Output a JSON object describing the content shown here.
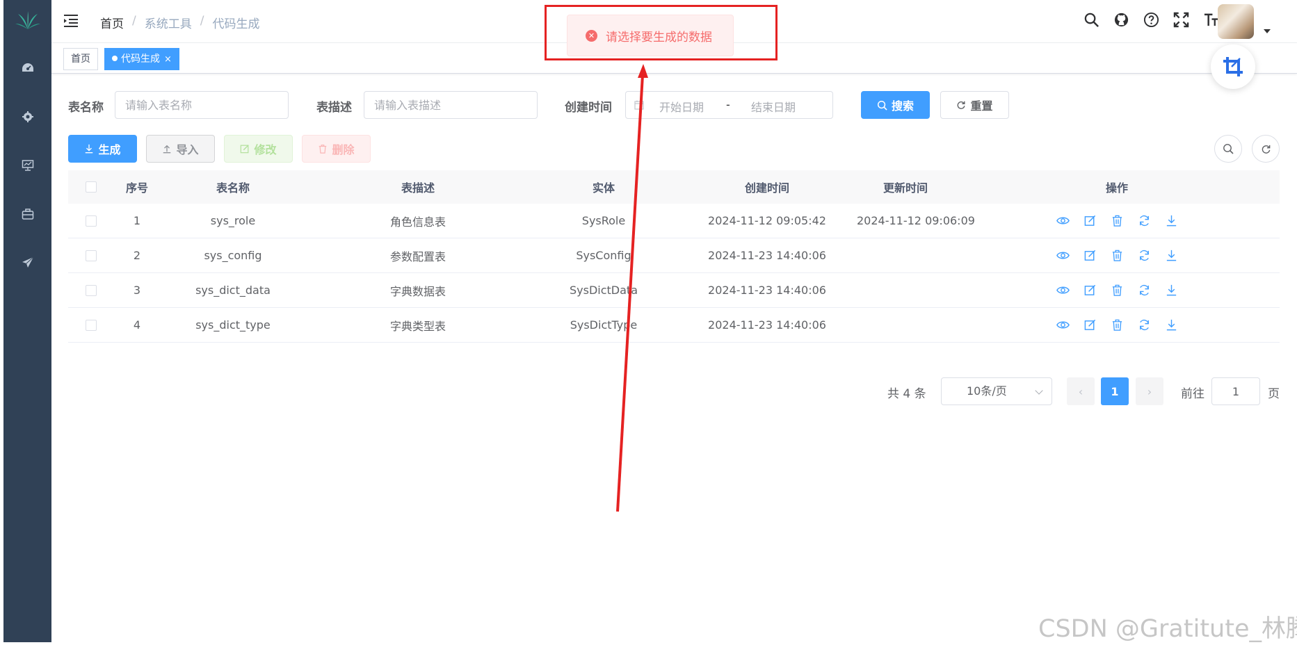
{
  "sidebar": {
    "logo": "leaf-logo",
    "items": [
      {
        "icon": "dashboard-icon"
      },
      {
        "icon": "gear-icon"
      },
      {
        "icon": "monitor-icon"
      },
      {
        "icon": "toolbox-icon"
      },
      {
        "icon": "send-icon"
      }
    ]
  },
  "header": {
    "breadcrumb": {
      "home": "首页",
      "sep1": "/",
      "mid": "系统工具",
      "sep2": "/",
      "current": "代码生成"
    },
    "icons": [
      "search-icon",
      "github-icon",
      "help-icon",
      "fullscreen-icon",
      "font-size-icon"
    ]
  },
  "tags": {
    "home": "首页",
    "active": "代码生成",
    "close": "×"
  },
  "search": {
    "table_name_label": "表名称",
    "table_name_placeholder": "请输入表名称",
    "table_desc_label": "表描述",
    "table_desc_placeholder": "请输入表描述",
    "create_time_label": "创建时间",
    "start_placeholder": "开始日期",
    "range_sep": "-",
    "end_placeholder": "结束日期",
    "search_button": "搜索",
    "reset_button": "重置"
  },
  "toolbar": {
    "generate": "生成",
    "import": "导入",
    "edit": "修改",
    "delete": "删除"
  },
  "table": {
    "columns": {
      "index": "序号",
      "name": "表名称",
      "desc": "表描述",
      "entity": "实体",
      "created": "创建时间",
      "updated": "更新时间",
      "ops": "操作"
    },
    "rows": [
      {
        "index": "1",
        "name": "sys_role",
        "desc": "角色信息表",
        "entity": "SysRole",
        "created": "2024-11-12 09:05:42",
        "updated": "2024-11-12 09:06:09"
      },
      {
        "index": "2",
        "name": "sys_config",
        "desc": "参数配置表",
        "entity": "SysConfig",
        "created": "2024-11-23 14:40:06",
        "updated": ""
      },
      {
        "index": "3",
        "name": "sys_dict_data",
        "desc": "字典数据表",
        "entity": "SysDictData",
        "created": "2024-11-23 14:40:06",
        "updated": ""
      },
      {
        "index": "4",
        "name": "sys_dict_type",
        "desc": "字典类型表",
        "entity": "SysDictType",
        "created": "2024-11-23 14:40:06",
        "updated": ""
      }
    ]
  },
  "pagination": {
    "total": "共 4 条",
    "page_size": "10条/页",
    "prev": "‹",
    "current": "1",
    "next": "›",
    "goto_label": "前往",
    "goto_value": "1",
    "page_label": "页"
  },
  "toast": {
    "message": "请选择要生成的数据",
    "icon": "error-circle-icon"
  },
  "watermark": "CSDN @Gratitute_林腾",
  "colors": {
    "primary": "#409eff",
    "sidebar": "#304156",
    "error": "#f56c6c",
    "annotation": "#e52222"
  }
}
